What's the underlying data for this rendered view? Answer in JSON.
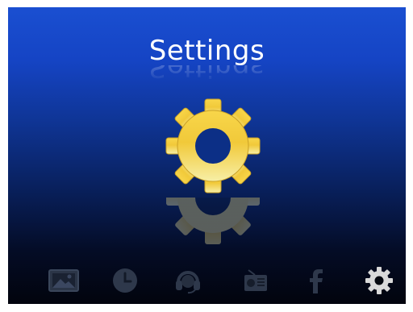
{
  "screen": {
    "title": "Settings",
    "main_icon": "gear-icon"
  },
  "dock": {
    "items": [
      {
        "icon": "image-icon",
        "state": "inactive"
      },
      {
        "icon": "clock-icon",
        "state": "inactive"
      },
      {
        "icon": "headset-icon",
        "state": "inactive"
      },
      {
        "icon": "radio-icon",
        "state": "inactive"
      },
      {
        "icon": "facebook-icon",
        "state": "inactive"
      },
      {
        "icon": "settings-gear-icon",
        "state": "active"
      }
    ]
  },
  "colors": {
    "background_top": "#1a4fd1",
    "background_bottom": "#02040d",
    "gear_light": "#f6eea2",
    "gear_dark": "#e9b92c",
    "dock_inactive": "#2b3547",
    "dock_active": "#d8d8d8"
  }
}
